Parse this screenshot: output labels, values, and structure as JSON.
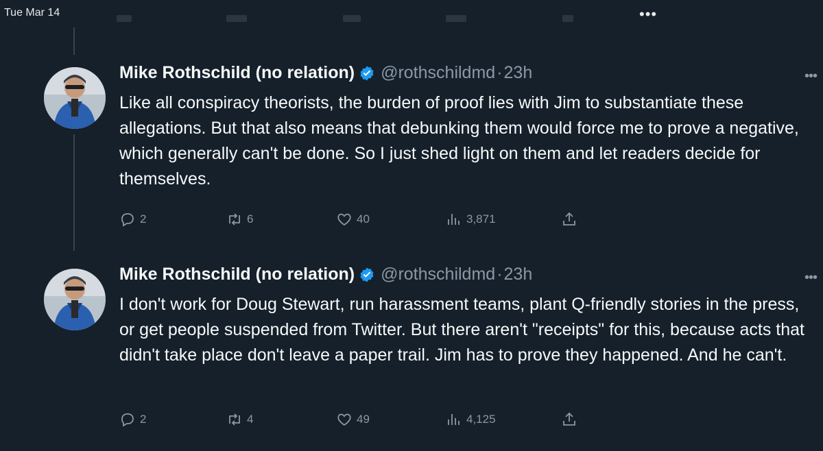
{
  "status_bar": {
    "date": "Tue Mar 14",
    "dots": "•••"
  },
  "tweets": [
    {
      "name": "Mike Rothschild (no relation)",
      "handle": "@rothschildmd",
      "separator": "·",
      "time": "23h",
      "more": "•••",
      "text": "Like all conspiracy theorists, the burden of proof lies with Jim to substantiate these allegations. But that also means that debunking them would force me to prove a negative, which generally can't be done. So I just shed light on them and let readers decide for themselves.",
      "replies": "2",
      "retweets": "6",
      "likes": "40",
      "views": "3,871"
    },
    {
      "name": "Mike Rothschild (no relation)",
      "handle": "@rothschildmd",
      "separator": "·",
      "time": "23h",
      "more": "•••",
      "text": "I don't work for Doug Stewart, run harassment teams, plant Q-friendly stories in the press, or get people suspended from Twitter. But there aren't \"receipts\" for this, because acts that didn't take place don't leave a paper trail. Jim has to prove they happened. And he can't.",
      "replies": "2",
      "retweets": "4",
      "likes": "49",
      "views": "4,125"
    }
  ],
  "colors": {
    "background": "#15202b",
    "verified": "#1d9bf0",
    "muted": "#8b98a5"
  }
}
